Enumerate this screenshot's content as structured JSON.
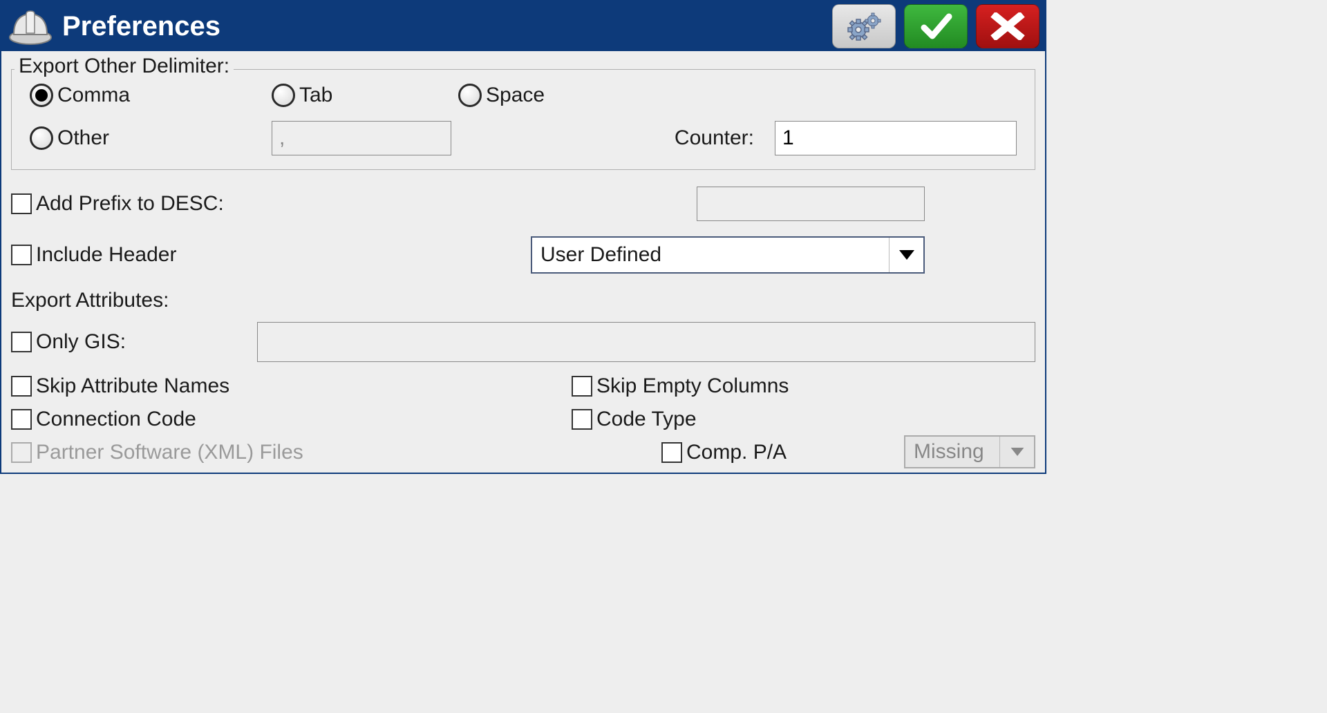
{
  "title": "Preferences",
  "fieldset": {
    "legend": "Export Other Delimiter:",
    "radios": {
      "comma": "Comma",
      "tab": "Tab",
      "space": "Space",
      "other": "Other"
    },
    "other_value": ",",
    "counter_label": "Counter:",
    "counter_value": "1"
  },
  "options": {
    "add_prefix_label": "Add Prefix to DESC:",
    "add_prefix_value": "",
    "include_header_label": "Include Header",
    "header_dropdown": "User Defined",
    "export_attr_label": "Export Attributes:",
    "only_gis_label": "Only GIS:",
    "only_gis_value": "",
    "skip_attr_label": "Skip Attribute Names",
    "skip_empty_label": "Skip Empty Columns",
    "conn_code_label": "Connection Code",
    "code_type_label": "Code Type",
    "partner_label": "Partner Software (XML) Files",
    "comp_pa_label": "Comp. P/A",
    "missing_dropdown": "Missing"
  }
}
